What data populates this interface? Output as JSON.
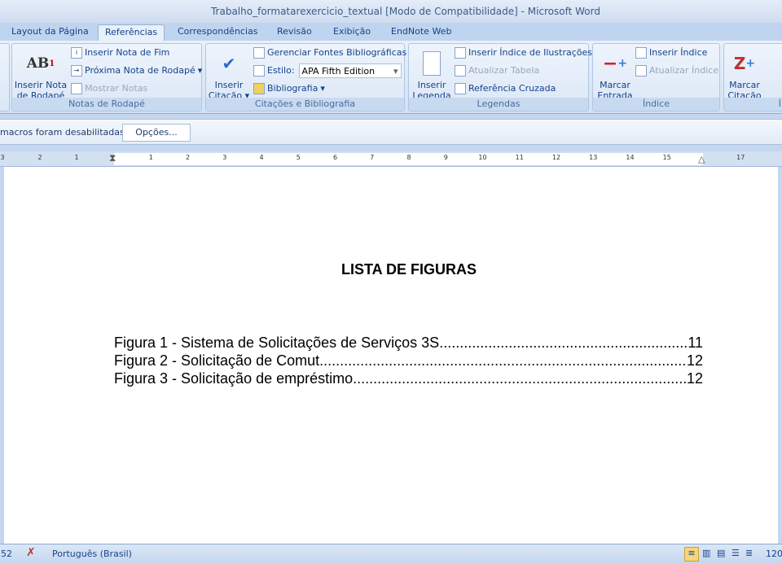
{
  "window": {
    "title": "Trabalho_formatarexercicio_textual [Modo de Compatibilidade] - Microsoft Word"
  },
  "tabs": [
    "Layout da Página",
    "Referências",
    "Correspondências",
    "Revisão",
    "Exibição",
    "EndNote Web"
  ],
  "active_tab": "Referências",
  "ribbon": {
    "notas": {
      "label": "Notas de Rodapé",
      "inserir_nota": "Inserir Nota de Rodapé",
      "inserir_nota_fim": "Inserir Nota de Fim",
      "proxima_nota": "Próxima Nota de Rodapé",
      "mostrar_notas": "Mostrar Notas"
    },
    "citacoes": {
      "label": "Citações e Bibliografia",
      "inserir_citacao": "Inserir Citação",
      "gerenciar": "Gerenciar Fontes Bibliográficas",
      "estilo_label": "Estilo:",
      "estilo_value": "APA Fifth Edition",
      "bibliografia": "Bibliografia"
    },
    "legendas": {
      "label": "Legendas",
      "inserir_legenda": "Inserir Legenda",
      "inserir_indice_ilustracoes": "Inserir Índice de Ilustrações",
      "atualizar_tabela": "Atualizar Tabela",
      "referencia_cruzada": "Referência Cruzada"
    },
    "indice": {
      "label": "Índice",
      "marcar_entrada": "Marcar Entrada",
      "inserir_indice": "Inserir Índice",
      "atualizar_indice": "Atualizar Índice"
    },
    "indice_autoridades": {
      "label": "Índ",
      "marcar_citacao": "Marcar Citação"
    }
  },
  "message_bar": {
    "text": "macros foram desabilitadas.",
    "options_button": "Opções..."
  },
  "ruler": {
    "left_numbers": [
      "3",
      "2",
      "1"
    ],
    "right_numbers": [
      "1",
      "2",
      "3",
      "4",
      "5",
      "6",
      "7",
      "8",
      "9",
      "10",
      "11",
      "12",
      "13",
      "14",
      "15",
      "17"
    ]
  },
  "document": {
    "title": "LISTA DE FIGURAS",
    "entries": [
      {
        "text": "Figura 1 - Sistema de Solicitações de Serviços 3S",
        "page": "11"
      },
      {
        "text": "Figura 2 - Solicitação de Comut",
        "page": "12"
      },
      {
        "text": "Figura 3 - Solicitação de empréstimo",
        "page": "12"
      }
    ]
  },
  "status": {
    "words": "52",
    "language": "Português (Brasil)",
    "zoom": "120"
  }
}
